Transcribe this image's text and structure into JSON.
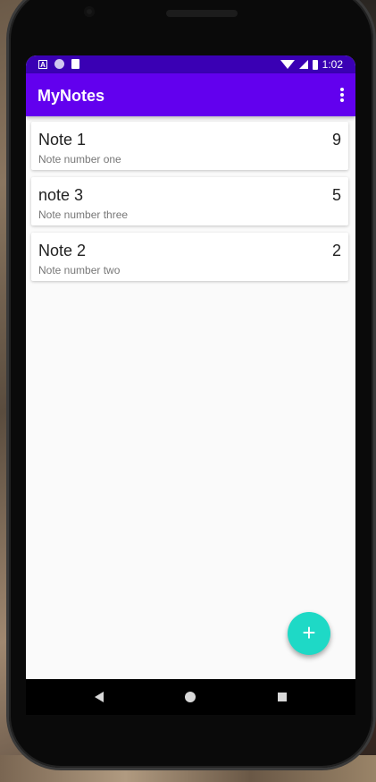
{
  "status_bar": {
    "time": "1:02",
    "left_icons": [
      "a-notification-icon",
      "circle-notification-icon",
      "sd-card-icon"
    ],
    "right_icons": [
      "wifi-icon",
      "signal-icon",
      "battery-icon"
    ],
    "a_glyph": "A"
  },
  "app_bar": {
    "title": "MyNotes",
    "color": "#6200ee",
    "status_color": "#3a00b4",
    "menu_icon": "more-vert-icon"
  },
  "notes": [
    {
      "title": "Note 1",
      "description": "Note number one",
      "priority": "9"
    },
    {
      "title": "note 3",
      "description": "Note number three",
      "priority": "5"
    },
    {
      "title": "Note 2",
      "description": "Note number two",
      "priority": "2"
    }
  ],
  "fab": {
    "icon": "add-icon",
    "glyph": "+",
    "color": "#1ed9c6"
  },
  "nav_bar": {
    "icons": [
      "back-icon",
      "home-icon",
      "recents-icon"
    ]
  }
}
